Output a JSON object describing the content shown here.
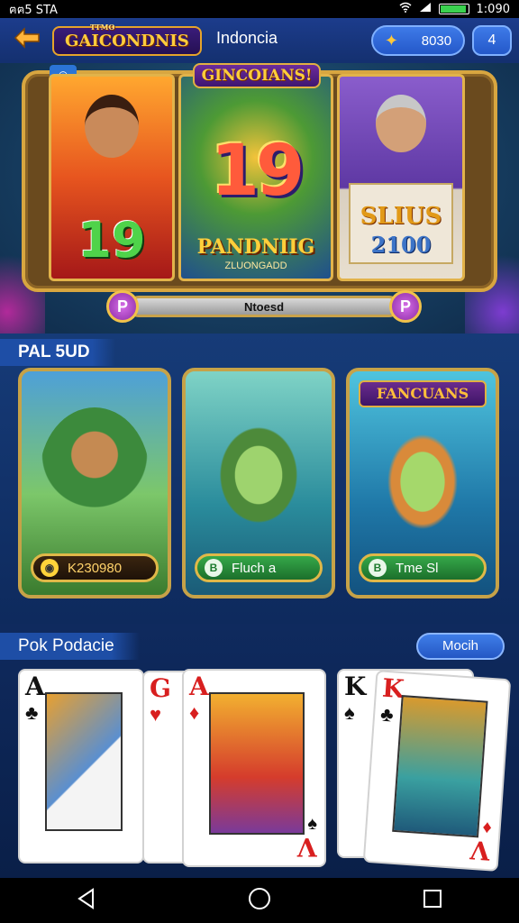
{
  "status_bar": {
    "left_text": "ฅฅ5 STA",
    "time": "1:090",
    "battery_level": 0.9
  },
  "header": {
    "logo_text": "GAICONDNIS",
    "logo_sub": "TTMO",
    "title": "Indoncia",
    "coins": "8030",
    "menu_label": "4"
  },
  "hero": {
    "frame_title": "GINCOIANS!",
    "ribbon": "◎",
    "panel1_number": "19",
    "panel2_number": "19",
    "panel2_label": "PANDNIIG",
    "panel2_sub": "ZLUONGADD",
    "panel3_label": "SLIUS",
    "panel3_number": "2100",
    "progress_label": "Ntoesd",
    "progress_level": 1.0,
    "knob_left": "P",
    "knob_right": "P"
  },
  "section2": {
    "title": "PAL 5UD",
    "cards": [
      {
        "banner": "",
        "button_icon": "◉",
        "button_label": "K230980"
      },
      {
        "banner": "",
        "button_icon": "B",
        "button_label": "Fluch a"
      },
      {
        "banner": "FANCUANS",
        "button_icon": "B",
        "button_label": "Tme Sl"
      }
    ]
  },
  "section3": {
    "title": "Pok Podacie",
    "mode_button": "Mocih",
    "cards": [
      {
        "rank": "A",
        "suit": "♣",
        "corner_rank": "",
        "corner_suit": "",
        "color": "black"
      },
      {
        "rank": "G",
        "suit": "♥",
        "corner_rank": "",
        "corner_suit": "",
        "color": "red"
      },
      {
        "rank": "A",
        "suit": "♦",
        "corner_rank": "V",
        "corner_suit": "♠",
        "color": "red"
      },
      {
        "rank": "K",
        "suit": "♠",
        "corner_rank": "",
        "corner_suit": "",
        "color": "black"
      },
      {
        "rank": "K",
        "suit": "♣",
        "corner_rank": "V",
        "corner_suit": "♦",
        "color": "red"
      }
    ]
  },
  "colors": {
    "gold": "#d8a640",
    "header_blue": "#1c3c8c",
    "button_green": "#36a84a",
    "accent_purple": "#6a2b8e"
  }
}
